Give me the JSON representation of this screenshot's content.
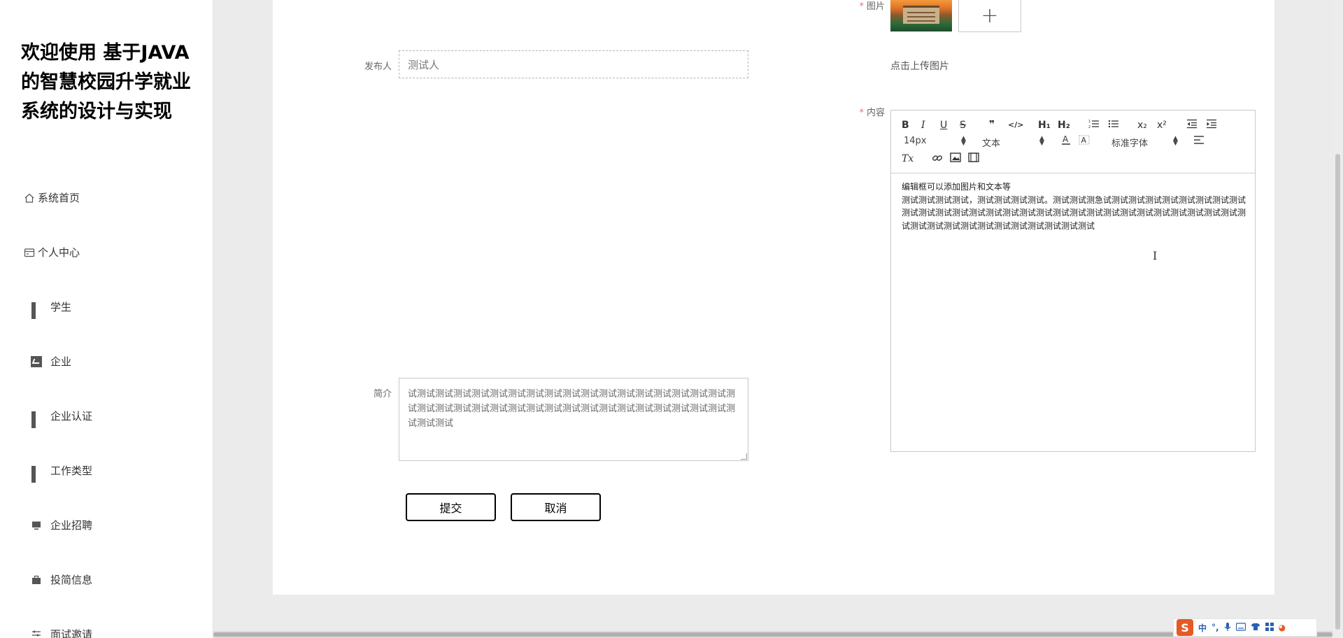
{
  "sidebar": {
    "brand": "欢迎使用 基于JAVA的智慧校园升学就业系统的设计与实现",
    "items": [
      {
        "label": "系统首页",
        "icon": "home-icon"
      },
      {
        "label": "个人中心",
        "icon": "card-icon"
      },
      {
        "label": "学生",
        "icon": "grid-icon"
      },
      {
        "label": "企业",
        "icon": "chart-icon"
      },
      {
        "label": "企业认证",
        "icon": "grid-icon"
      },
      {
        "label": "工作类型",
        "icon": "grid-icon"
      },
      {
        "label": "企业招聘",
        "icon": "monitor-icon"
      },
      {
        "label": "投简信息",
        "icon": "briefcase-icon"
      },
      {
        "label": "面试邀请",
        "icon": "sliders-icon"
      }
    ]
  },
  "form": {
    "publisher_label": "发布人",
    "publisher_value": "测试人",
    "image_label": "图片",
    "upload_hint": "点击上传图片",
    "content_label": "内容",
    "summary_label": "简介",
    "summary_value": "试测试测试测试测试测试测试测试测试测试测试测试测试测试测试测试测试测试测试测试测试测试测试测试测试测试测试测试测试测试测试测试测试测试测试测试测试测试测试",
    "submit_label": "提交",
    "cancel_label": "取消"
  },
  "editor": {
    "toolbar": {
      "bold": "B",
      "italic": "I",
      "underline": "U",
      "strike": "S",
      "quote": "❞",
      "code": "</>",
      "h1": "H₁",
      "h2": "H₂",
      "sub": "x₂",
      "sup": "x²",
      "size_value": "14px",
      "heading_value": "文本",
      "font_value": "标准字体",
      "clear": "Tx"
    },
    "content_line1": "编辑框可以添加图片和文本等",
    "content_line2": "测试测试测试测试，测试测试测试测试。测试测试测急试测试测试测试测试测试测试测试测试测试测试测试测试测试测试测试测试测试测试测试测试测试测试测试测试测试测试测试测试测试测试测试测试测试测试测试测试测试测试测试测试"
  },
  "ime": {
    "mode": "中"
  },
  "colors": {
    "required": "#f56c6c",
    "panel": "#ffffff",
    "background": "#ebebeb"
  }
}
